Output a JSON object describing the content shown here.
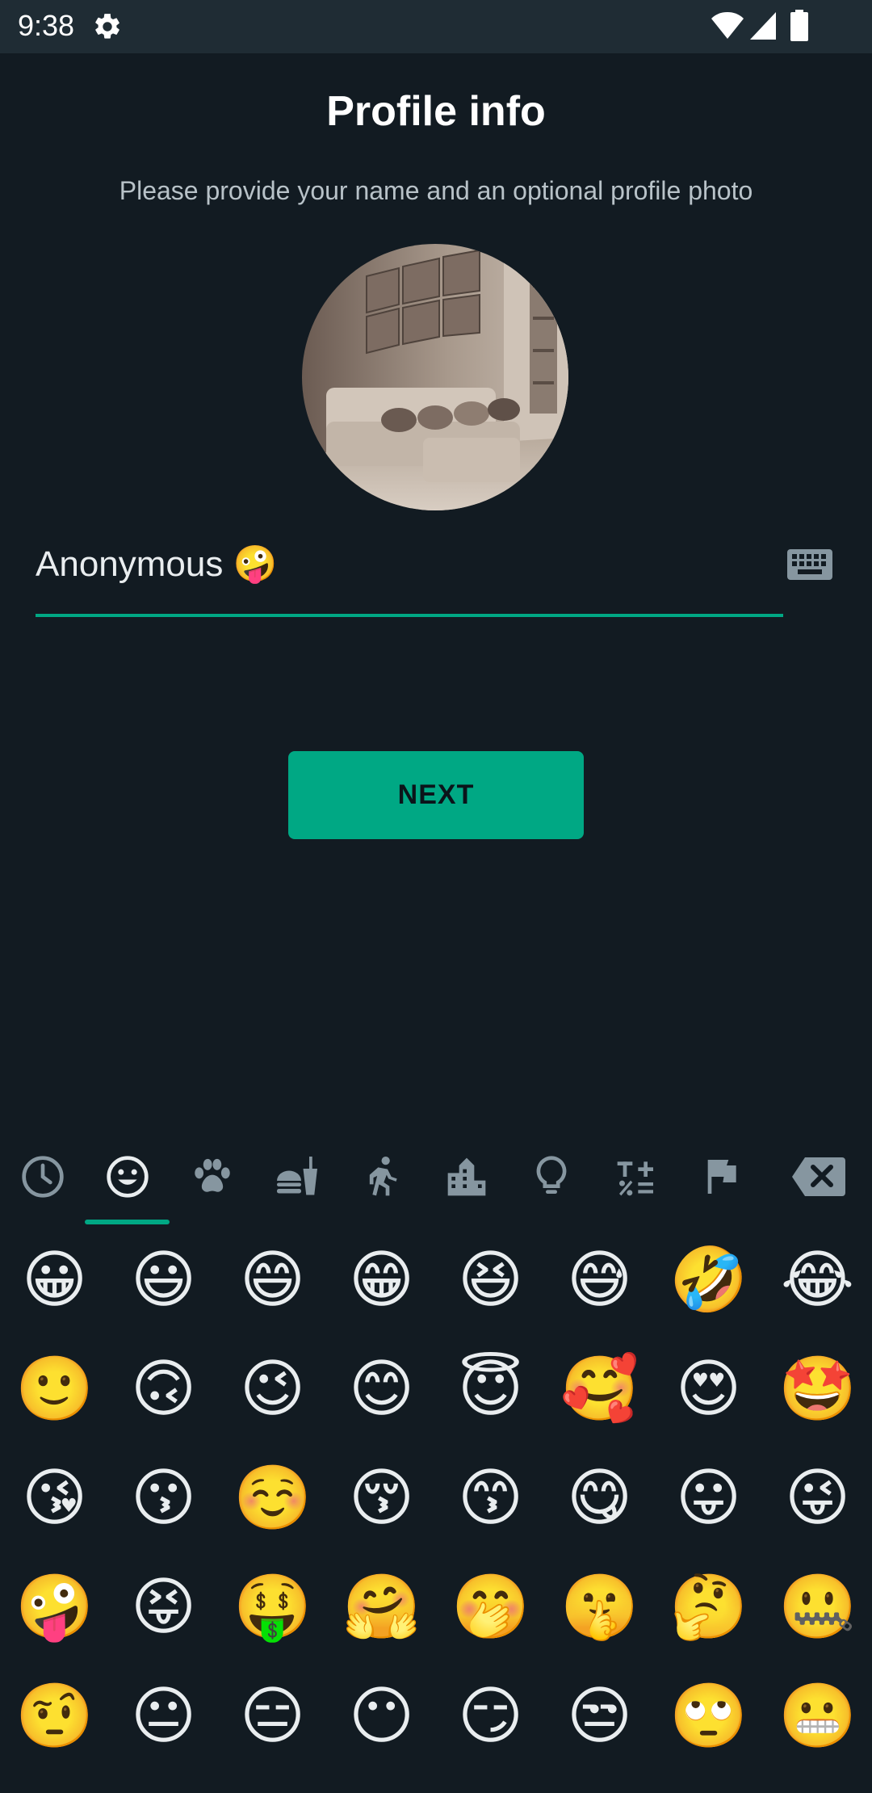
{
  "status_bar": {
    "time": "9:38",
    "icons": [
      "gear-icon",
      "wifi-icon",
      "signal-icon",
      "battery-icon"
    ]
  },
  "header": {
    "title": "Profile info",
    "subtitle": "Please provide your name and an optional profile photo"
  },
  "profile": {
    "photo": "living-room-photo",
    "name_value": "Anonymous 🤪"
  },
  "actions": {
    "next_label": "NEXT"
  },
  "emoji_panel": {
    "tabs": [
      "recent-icon",
      "smileys-icon",
      "animals-icon",
      "food-icon",
      "activity-icon",
      "travel-icon",
      "objects-icon",
      "symbols-icon",
      "flags-icon",
      "backspace-icon"
    ],
    "selected_tab": "smileys-icon",
    "rows": [
      [
        "😀",
        "😃",
        "😄",
        "😁",
        "😆",
        "😅",
        "🤣",
        "😂"
      ],
      [
        "🙂",
        "🙃",
        "😉",
        "😊",
        "😇",
        "🥰",
        "😍",
        "🤩"
      ],
      [
        "😘",
        "😗",
        "☺️",
        "😚",
        "😙",
        "😋",
        "😛",
        "😜"
      ],
      [
        "🤪",
        "😝",
        "🤑",
        "🤗",
        "🤭",
        "🤫",
        "🤔",
        "🤐"
      ],
      [
        "🤨",
        "😐",
        "😑",
        "😶",
        "😏",
        "😒",
        "🙄",
        "😬"
      ]
    ]
  },
  "colors": {
    "background": "#121b22",
    "status_bar": "#1f2c34",
    "accent": "#00a884",
    "icon_gray": "#8696a0"
  }
}
